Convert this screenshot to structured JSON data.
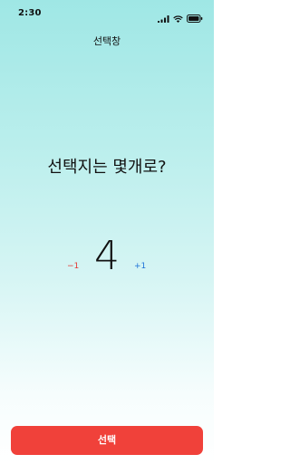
{
  "status_bar": {
    "time": "2:30",
    "icons": [
      "signal-icon",
      "wifi-icon",
      "battery-icon"
    ]
  },
  "nav": {
    "title": "선택창"
  },
  "main": {
    "question": "선택지는 몇개로?",
    "decrement_label": "−1",
    "count": "4",
    "increment_label": "+1"
  },
  "footer": {
    "select_label": "선택"
  },
  "colors": {
    "background_top": "#9fe7e5",
    "background_bottom": "#ffffff",
    "decrement": "#e53935",
    "increment": "#1e73d8",
    "button": "#f0413a"
  }
}
